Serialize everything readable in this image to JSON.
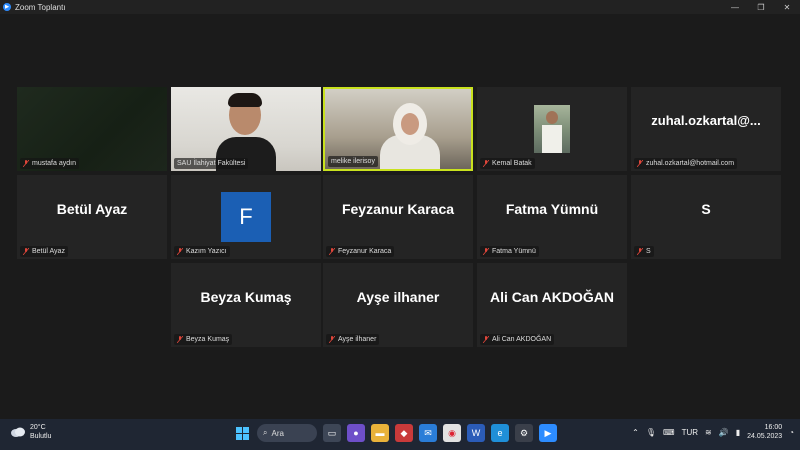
{
  "window": {
    "title": "Zoom Toplantı",
    "logo": "zoom"
  },
  "participants": [
    {
      "name": "mustafa aydın",
      "video": "dark"
    },
    {
      "name": "SAU İlahiyat Fakültesi",
      "video": "camera"
    },
    {
      "name": "melike ilerisoy",
      "video": "camera",
      "active": true
    },
    {
      "name": "Kemal Batak",
      "video": "photo"
    },
    {
      "name": "zuhal.ozkartal@hotmail.com",
      "display": "zuhal.ozkartal@..."
    },
    {
      "name": "Betül Ayaz",
      "display": "Betül Ayaz"
    },
    {
      "name": "Kazım Yazıcı",
      "display": "F"
    },
    {
      "name": "Feyzanur Karaca",
      "display": "Feyzanur Karaca"
    },
    {
      "name": "Fatma Yümnü",
      "display": "Fatma Yümnü"
    },
    {
      "name": "S",
      "display": "S"
    },
    {
      "name": "Beyza Kumaş",
      "display": "Beyza Kumaş"
    },
    {
      "name": "Ayşe ilhaner",
      "display": "Ayşe ilhaner"
    },
    {
      "name": "Ali Can AKDOĞAN",
      "display": "Ali Can AKDOĞAN"
    }
  ],
  "taskbar": {
    "weather": {
      "temp": "20°C",
      "desc": "Bulutlu"
    },
    "search_label": "Ara",
    "language": "TUR",
    "time": "16:00",
    "date": "24.05.2023"
  },
  "colors": {
    "active_border": "#c9e21e",
    "avatar_bg": "#1b5fb4",
    "mic_muted": "#e0463a"
  }
}
